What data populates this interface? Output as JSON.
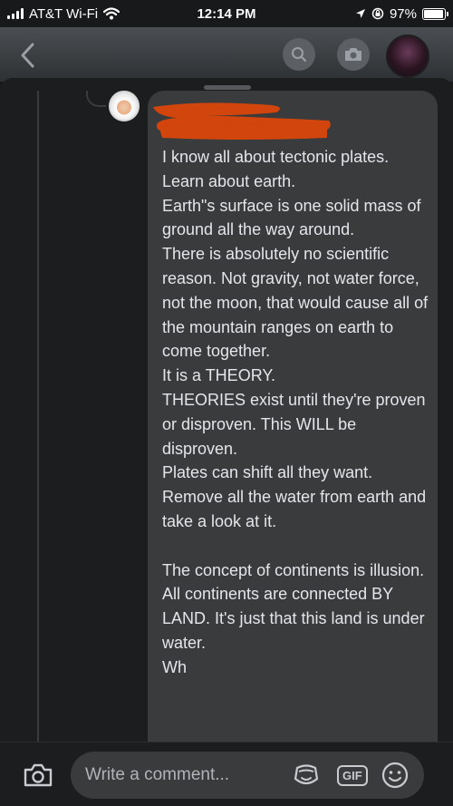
{
  "status_bar": {
    "carrier": "AT&T Wi-Fi",
    "time": "12:14 PM",
    "battery_percent": "97%",
    "battery_level": 0.97,
    "icons": [
      "signal-icon",
      "wifi-icon",
      "location-arrow-icon",
      "screen-lock-icon",
      "battery-icon"
    ]
  },
  "header": {
    "icons": [
      "back-chevron-icon",
      "search-icon",
      "camera-icon"
    ]
  },
  "comment": {
    "text": "I know all about tectonic plates.\nLearn about earth.\nEarth\"s surface is one solid mass of ground all the way around.\nThere is absolutely no scientific reason. Not gravity, not water force, not the moon, that would cause all of the mountain ranges on earth to come together.\nIt is a THEORY.\nTHEORIES exist until they're proven or disproven. This WILL be disproven.\nPlates can shift all they want.\nRemove all the water from earth and take a look at it.\n\nThe concept of continents is illusion.\nAll continents are connected BY LAND. It's just that this land is under water.\nWh",
    "redaction_color": "#d2450d"
  },
  "composer": {
    "placeholder": "Write a comment...",
    "gif_label": "GIF",
    "icons": [
      "camera-icon",
      "sticker-icon",
      "gif-icon",
      "emoji-icon"
    ]
  },
  "colors": {
    "background": "#18191a",
    "bubble": "#3a3b3c",
    "text": "#e4e6eb"
  }
}
